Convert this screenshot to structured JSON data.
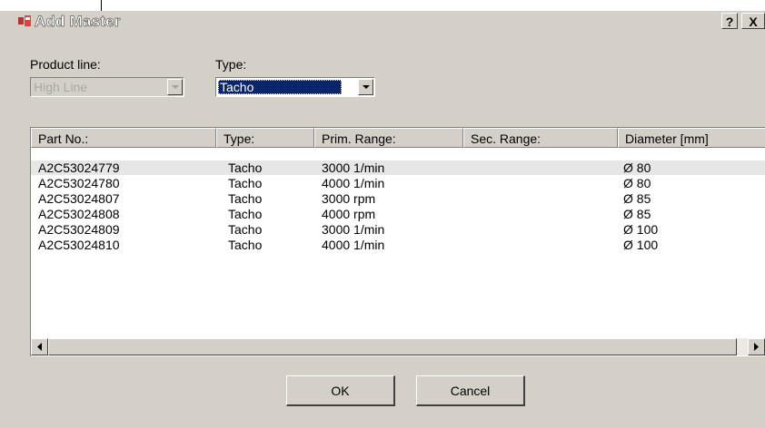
{
  "window": {
    "title": "Add Master",
    "help_label": "?",
    "close_label": "X"
  },
  "product_line": {
    "label": "Product line:",
    "value": "High Line",
    "enabled": false
  },
  "type": {
    "label": "Type:",
    "value": "Tacho"
  },
  "list": {
    "columns": [
      "Part No.:",
      "Type:",
      "Prim. Range:",
      "Sec. Range:",
      "Diameter [mm]"
    ],
    "rows": [
      [
        "A2C53024779",
        "Tacho",
        "3000 1/min",
        "",
        "Ø 80"
      ],
      [
        "A2C53024780",
        "Tacho",
        "4000 1/min",
        "",
        "Ø 80"
      ],
      [
        "A2C53024807",
        "Tacho",
        "3000 rpm",
        "",
        "Ø 85"
      ],
      [
        "A2C53024808",
        "Tacho",
        "4000 rpm",
        "",
        "Ø 85"
      ],
      [
        "A2C53024809",
        "Tacho",
        "3000 1/min",
        "",
        "Ø 100"
      ],
      [
        "A2C53024810",
        "Tacho",
        "4000 1/min",
        "",
        "Ø 100"
      ]
    ],
    "selected_row": 0
  },
  "buttons": {
    "ok": "OK",
    "cancel": "Cancel"
  }
}
